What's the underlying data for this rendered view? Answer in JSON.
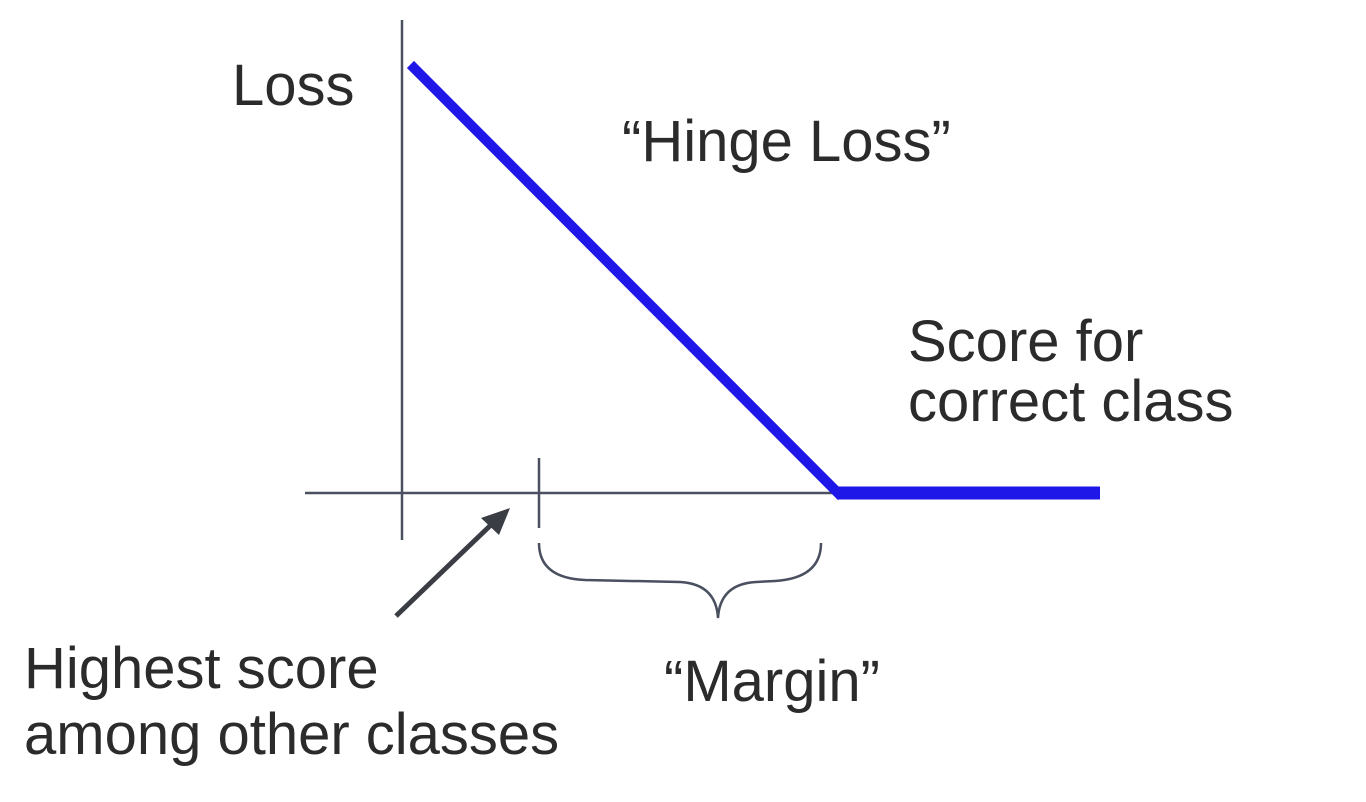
{
  "diagram": {
    "title": "“Hinge Loss”",
    "y_axis_label": "Loss",
    "x_axis_label_lines": [
      "Score for",
      "correct class"
    ],
    "other_classes_label_lines": [
      "Highest score",
      "among other classes"
    ],
    "margin_label": "“Margin”",
    "colors": {
      "curve": "#1f16e8",
      "axes": "#4a5060",
      "text": "#2b2b2b",
      "arrow": "#3a3d44",
      "brace": "#4a5060"
    }
  }
}
